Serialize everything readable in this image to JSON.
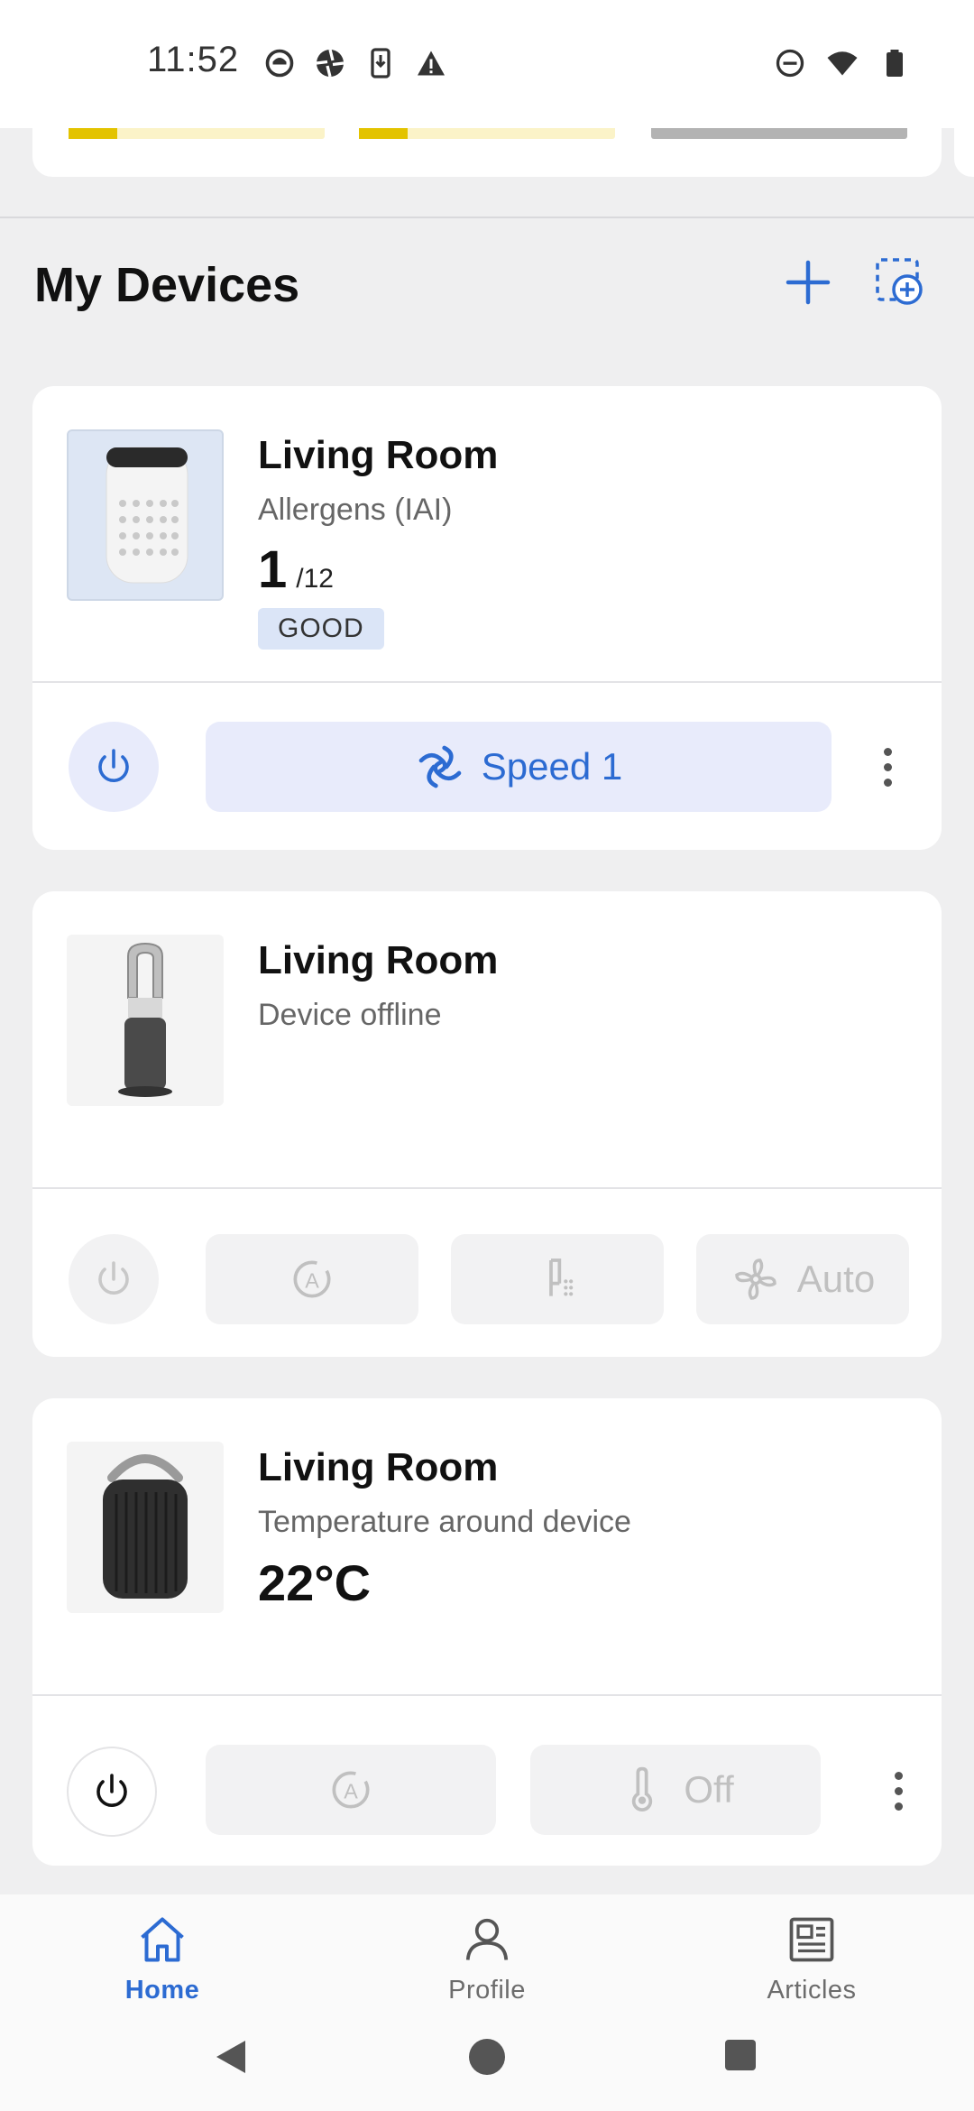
{
  "status_bar": {
    "time": "11:52",
    "left_icons": [
      "head-icon",
      "aperture-icon",
      "download-icon",
      "warning-icon"
    ],
    "right_icons": [
      "do-not-disturb-icon",
      "wifi-icon",
      "battery-icon"
    ]
  },
  "section": {
    "title": "My Devices",
    "add_icon": "plus-icon",
    "scan_icon": "add-device-scan-icon"
  },
  "devices": [
    {
      "name": "Living Room",
      "subtitle": "Allergens (IAI)",
      "value": "1",
      "value_max": "/12",
      "badge": "GOOD",
      "speed_label": "Speed 1",
      "controls": [
        "power-icon",
        "fan-speed-icon",
        "more-icon"
      ]
    },
    {
      "name": "Living Room",
      "subtitle": "Device offline",
      "fan_label": "Auto",
      "controls": [
        "power-icon",
        "auto-mode-icon",
        "humidity-icon",
        "fan-icon"
      ]
    },
    {
      "name": "Living Room",
      "subtitle": "Temperature around device",
      "value": "22°C",
      "heat_label": "Off",
      "controls": [
        "power-icon",
        "auto-mode-icon",
        "thermometer-icon",
        "more-icon"
      ]
    }
  ],
  "bottom_nav": {
    "items": [
      {
        "label": "Home",
        "icon": "home-icon",
        "active": true
      },
      {
        "label": "Profile",
        "icon": "profile-icon",
        "active": false
      },
      {
        "label": "Articles",
        "icon": "articles-icon",
        "active": false
      }
    ]
  },
  "colors": {
    "accent": "#2c6bd2",
    "good_badge_bg": "#dbe5f7",
    "speed_pill_bg": "#e8ebfb",
    "aqi_bar": "#e3c300",
    "aqi_bar_light": "#fbf3c8",
    "background": "#efeff0"
  }
}
